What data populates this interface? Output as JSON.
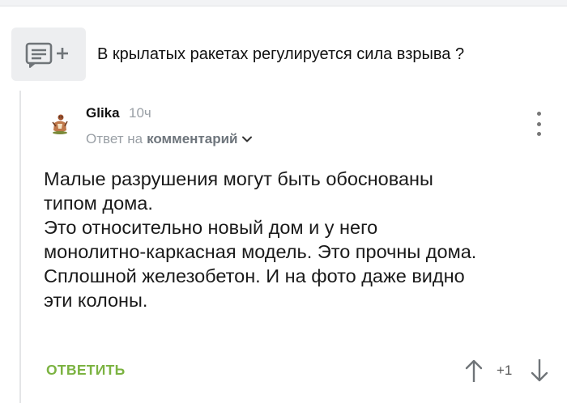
{
  "parent_comment": {
    "icon": "comment-add-icon",
    "text": "В крылатых ракетах регулируется сила взрыва ?"
  },
  "comment": {
    "avatar_icon": "user-avatar-icon",
    "username": "Glika",
    "time": "10ч",
    "reply_prefix": "Ответ на",
    "reply_link": "комментарий",
    "menu_icon": "more-vertical-icon",
    "body_lines": [
      "Малые разрушения могут быть обоснованы",
      "типом дома.",
      "Это относительно новый дом и у него",
      "монолитно-каркасная модель. Это прочны дома.",
      "Сплошной железобетон. И на фото даже видно",
      "эти колоны."
    ],
    "reply_label": "ОТВЕТИТЬ",
    "score": "+1",
    "upvote_icon": "arrow-up-icon",
    "downvote_icon": "arrow-down-icon"
  },
  "colors": {
    "accent_green": "#7cb342",
    "muted_text": "#9aa0a6",
    "icon_box_bg": "#edeef0"
  }
}
